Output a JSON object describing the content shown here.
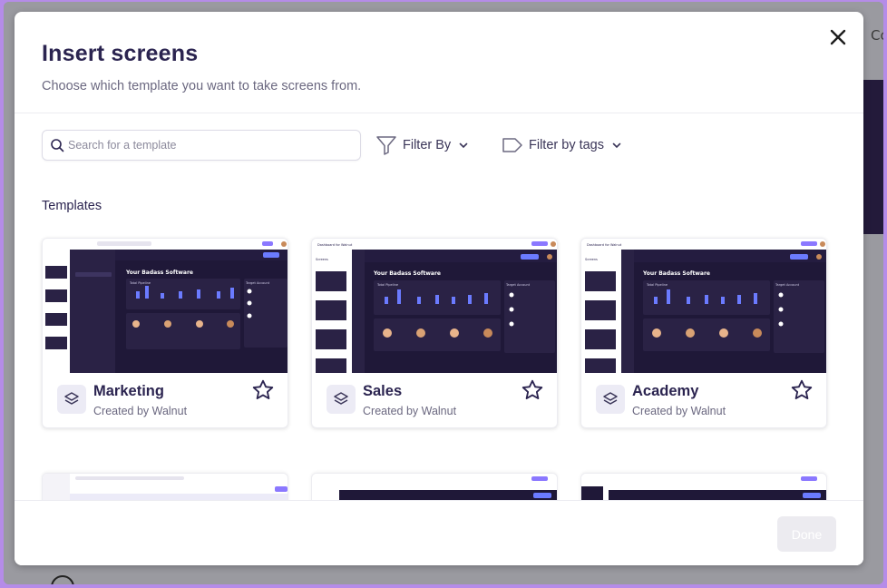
{
  "modal": {
    "title": "Insert screens",
    "subtitle": "Choose which template you want to take screens from."
  },
  "background": {
    "tab_fragment": "Co"
  },
  "search": {
    "placeholder": "Search for a template",
    "value": ""
  },
  "filters": {
    "filter_by_label": "Filter By",
    "filter_tags_label": "Filter by tags"
  },
  "section_label": "Templates",
  "templates": [
    {
      "title": "Marketing",
      "creator": "Created by Walnut",
      "thumb": {
        "app_title": "Dashboard for Walnut",
        "heading": "Your Badass Software",
        "panel_left": "Total Pipeline",
        "panel_right": "Target Account"
      }
    },
    {
      "title": "Sales",
      "creator": "Created by Walnut",
      "thumb": {
        "app_title": "Dashboard for Walnut",
        "heading": "Your Badass Software",
        "panel_left": "Total Pipeline",
        "panel_right": "Target Account"
      }
    },
    {
      "title": "Academy",
      "creator": "Created by Walnut",
      "thumb": {
        "app_title": "Dashboard for Walnut",
        "heading": "Your Badass Software",
        "panel_left": "Total Pipeline",
        "panel_right": "Target Account"
      }
    }
  ],
  "footer": {
    "done_label": "Done"
  },
  "colors": {
    "accent": "#6c5ce7",
    "title": "#2b2450",
    "thumb_dark": "#1f1838",
    "thumb_bar": "#6b7bff"
  },
  "icons": {
    "close": "close-icon",
    "search": "search-icon",
    "filter": "filter-icon",
    "tag": "tag-icon",
    "chevron": "chevron-down-icon",
    "layers": "layers-icon",
    "star": "star-icon"
  }
}
